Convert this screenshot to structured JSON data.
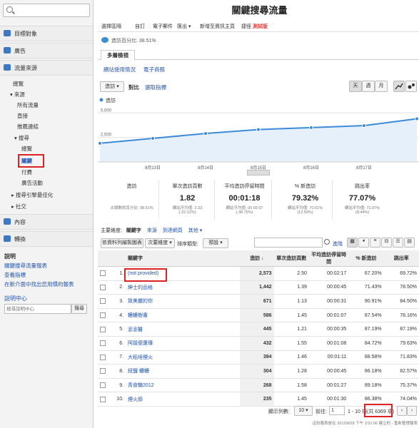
{
  "sidebar": {
    "sections": [
      {
        "label": "目標對象",
        "color": "#3b78c5"
      },
      {
        "label": "廣告",
        "color": "#3b78c5"
      },
      {
        "label": "流量來源",
        "color": "#3b78c5"
      }
    ],
    "traffic_items": [
      "總覽",
      "來源",
      "所有流量",
      "直接",
      "推薦連結",
      "搜尋",
      "總覽",
      "關鍵",
      "付費",
      "廣告活動",
      "搜尋引擎最佳化",
      "社交"
    ],
    "content_label": "內容",
    "conversion_label": "轉換",
    "help": {
      "title": "說明",
      "links": [
        "關鍵搜尋流量報表",
        "查看指標",
        "在新介面中找出您用慣的報表"
      ],
      "center_title": "說明中心",
      "search_placeholder": "搜尋說明中心",
      "search_button": "搜尋"
    }
  },
  "header": {
    "title": "關鍵搜尋流量",
    "toolbar": [
      "選擇區隔",
      "自訂",
      "電子郵件",
      "匯出",
      "新增至資訊主頁",
      "捷徑"
    ],
    "beta": "測試版",
    "visits_pct_label": "造訪百分比: 38.51%"
  },
  "tabs": {
    "explorer": "多層檢視",
    "subtabs": [
      "網站使用情況",
      "電子商務"
    ]
  },
  "chart_controls": {
    "metric_select": "造訪",
    "vs_label": "對比",
    "select_metric": "選取指標",
    "period_buttons": [
      "天",
      "週",
      "月"
    ]
  },
  "chart_data": {
    "type": "line",
    "series_label": "造訪",
    "y_ticks": [
      "5,000",
      "2,500"
    ],
    "ylim": [
      0,
      5600
    ],
    "x": [
      "8/12",
      "8/13",
      "8/14",
      "8/15",
      "8/16",
      "8/17",
      "8/18"
    ],
    "x_ticks": [
      "8月13日",
      "8月14日",
      "8月15日",
      "8月16日",
      "8月17日"
    ],
    "values": [
      1900,
      2400,
      2900,
      3300,
      3500,
      3700,
      4400
    ],
    "color": "#3c8bd8",
    "grid": true
  },
  "metrics": [
    {
      "title": "造訪",
      "value": "",
      "sub1": "占總數的百分比: 38.51%",
      "sub2": ""
    },
    {
      "title": "單次造訪頁數",
      "value": "1.82",
      "sub1": "網站平均值: 2.33",
      "sub2": "(-22.12%)"
    },
    {
      "title": "平均造訪停留時間",
      "value": "00:01:18",
      "sub1": "網站平均值: 00:02:07",
      "sub2": "(-38.75%)"
    },
    {
      "title": "% 新造訪",
      "value": "79.32%",
      "sub1": "網站平均值: 70.51%",
      "sub2": "(12.50%)"
    },
    {
      "title": "跳出率",
      "value": "77.07%",
      "sub1": "網站平均值: 71.07%",
      "sub2": "(8.44%)"
    }
  ],
  "dimension_row": {
    "label": "主要維度:",
    "active": "關鍵字",
    "options": [
      "來源",
      "到達網頁",
      "其他"
    ]
  },
  "filter_row": {
    "plot_rows": "依資料列繪製圖表",
    "secondary": "次要維度",
    "sort_label": "排序類型:",
    "sort_value": "預設",
    "advanced": "進階"
  },
  "table": {
    "headers": [
      "關鍵字",
      "造訪",
      "單次造訪頁數",
      "平均造訪停留時間",
      "% 新造訪",
      "跳出率"
    ],
    "rows": [
      {
        "n": "1.",
        "kw": "(not provided)",
        "visits": "2,573",
        "ppv": "2.50",
        "avg": "00:02:17",
        "new": "67.20%",
        "bounce": "69.72%"
      },
      {
        "n": "2.",
        "kw": "紳士的品格",
        "visits": "1,442",
        "ppv": "1.39",
        "avg": "00:00:45",
        "new": "71.43%",
        "bounce": "78.50%"
      },
      {
        "n": "3.",
        "kw": "致美麗的你",
        "visits": "671",
        "ppv": "1.13",
        "avg": "00:00:31",
        "new": "90.91%",
        "bounce": "84.50%"
      },
      {
        "n": "4.",
        "kw": "轆轆樹書",
        "visits": "586",
        "ppv": "1.45",
        "avg": "00:01:07",
        "new": "87.54%",
        "bounce": "78.16%"
      },
      {
        "n": "5.",
        "kw": "澎澎醫",
        "visits": "445",
        "ppv": "1.21",
        "avg": "00:00:35",
        "new": "87.19%",
        "bounce": "87.19%"
      },
      {
        "n": "6.",
        "kw": "阿跋便還傳",
        "visits": "432",
        "ppv": "1.55",
        "avg": "00:01:08",
        "new": "84.72%",
        "bounce": "79.63%"
      },
      {
        "n": "7.",
        "kw": "大稻埕煙火",
        "visits": "394",
        "ppv": "1.46",
        "avg": "00:01:11",
        "new": "88.58%",
        "bounce": "71.83%"
      },
      {
        "n": "8.",
        "kw": "紐鹽 轆轆",
        "visits": "304",
        "ppv": "1.28",
        "avg": "00:00:45",
        "new": "86.18%",
        "bounce": "82.57%"
      },
      {
        "n": "9.",
        "kw": "青食糖2012",
        "visits": "268",
        "ppv": "1.58",
        "avg": "00:01:27",
        "new": "89.18%",
        "bounce": "75.37%"
      },
      {
        "n": "10.",
        "kw": "煙火節",
        "visits": "235",
        "ppv": "1.45",
        "avg": "00:01:30",
        "new": "86.38%",
        "bounce": "74.04%"
      }
    ]
  },
  "pagination": {
    "show_rows_label": "顯示列數:",
    "rows_value": "10",
    "goto_label": "前往:",
    "goto_value": "1",
    "range": "1 - 10 項",
    "total": "(共 6369 項)"
  },
  "footer": "這份報表是在 2012/8/28 下午 3:52:06 建立的 - 重新整理報表"
}
